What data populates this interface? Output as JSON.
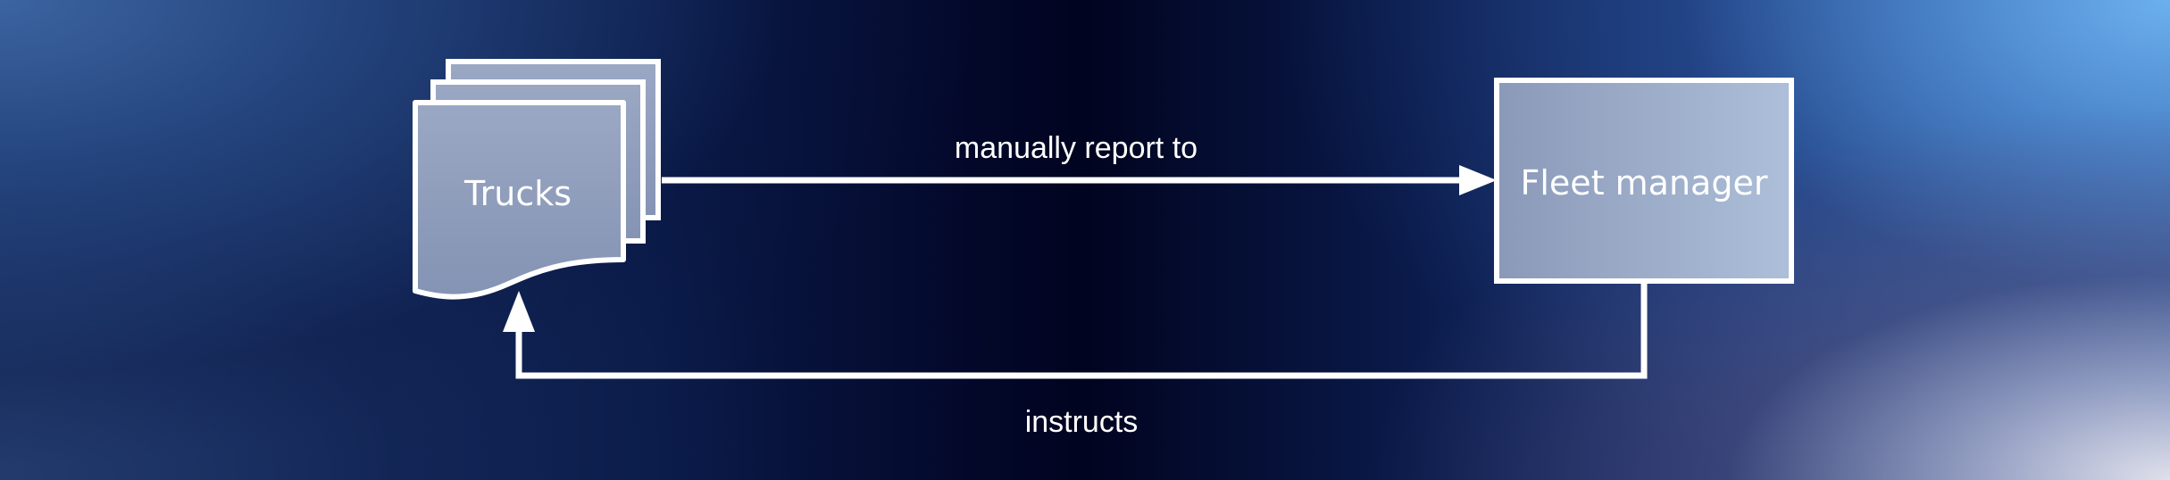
{
  "nodes": {
    "trucks": {
      "label": "Trucks"
    },
    "fleet_manager": {
      "label": "Fleet manager"
    }
  },
  "edges": {
    "report": {
      "label": "manually report to"
    },
    "instructs": {
      "label": "instructs"
    }
  },
  "colors": {
    "stroke": "#ffffff",
    "node_fill_start": "#8c9bbb",
    "node_fill_end": "#a8bad6"
  }
}
